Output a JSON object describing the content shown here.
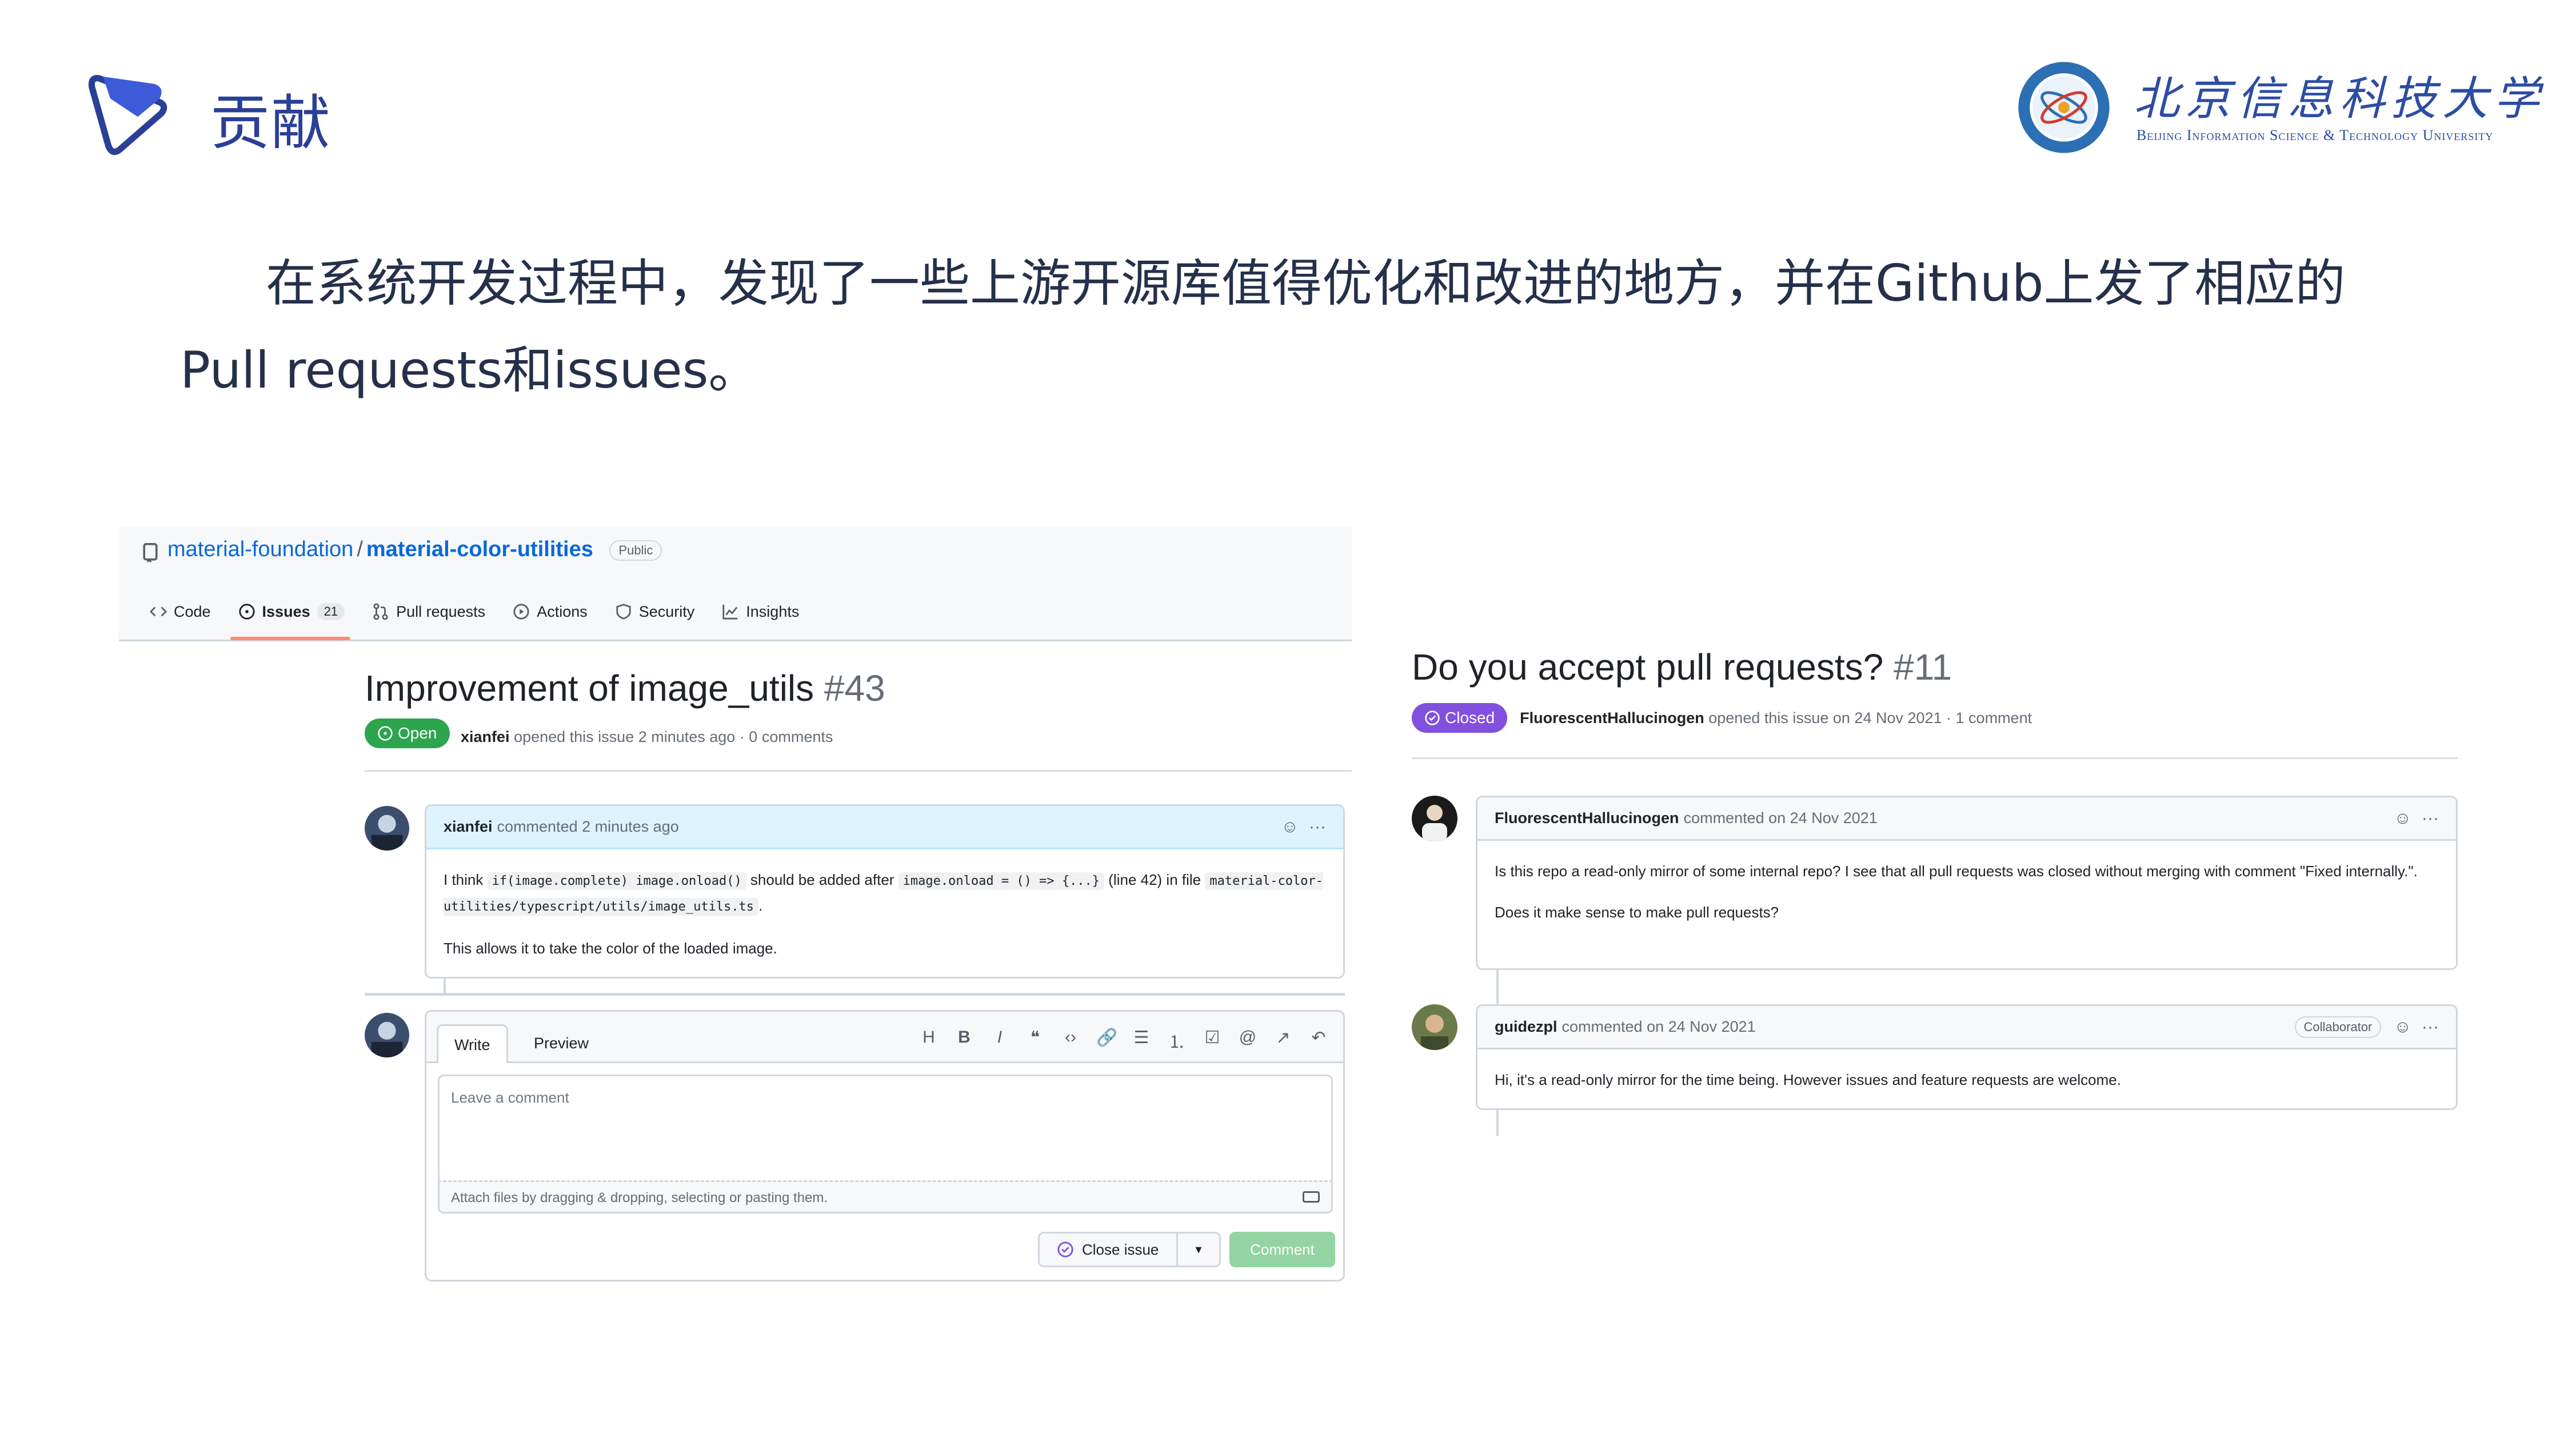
{
  "slide": {
    "title": "贡献",
    "university_cn": "北京信息科技大学",
    "university_en": "Beijing Information Science & Technology University",
    "intro": "在系统开发过程中，发现了一些上游开源库值得优化和改进的地方，并在Github上发了相应的Pull requests和issues。"
  },
  "left_issue": {
    "repo_owner": "material-foundation",
    "repo_sep": "/",
    "repo_name": "material-color-utilities",
    "visibility": "Public",
    "tabs": [
      {
        "label": "Code",
        "icon": "code-icon"
      },
      {
        "label": "Issues",
        "icon": "issue-icon",
        "counter": "21",
        "selected": true
      },
      {
        "label": "Pull requests",
        "icon": "pull-request-icon"
      },
      {
        "label": "Actions",
        "icon": "play-icon"
      },
      {
        "label": "Security",
        "icon": "shield-icon"
      },
      {
        "label": "Insights",
        "icon": "graph-icon"
      }
    ],
    "title": "Improvement of image_utils",
    "number": "#43",
    "state": "Open",
    "author": "xianfei",
    "meta": "opened this issue 2 minutes ago · 0 comments",
    "comment": {
      "author": "xianfei",
      "time": "commented 2 minutes ago",
      "p1_a": "I think ",
      "p1_code1": "if(image.complete) image.onload()",
      "p1_b": " should be added after ",
      "p1_code2": "image.onload = () => {...}",
      "p1_c": " (line 42) in file ",
      "p1_code3": "material-color-utilities/typescript/utils/image_utils.ts",
      "p1_d": ".",
      "p2": "This allows it to take the color of the loaded image."
    },
    "editor": {
      "tab_write": "Write",
      "tab_preview": "Preview",
      "toolbar": [
        "H",
        "B",
        "I",
        "❝",
        "‹›",
        "🔗",
        "☰",
        "⒈",
        "☑",
        "@",
        "↗",
        "↶"
      ],
      "placeholder": "Leave a comment",
      "attach": "Attach files by dragging & dropping, selecting or pasting them.",
      "close_button": "Close issue",
      "comment_button": "Comment"
    }
  },
  "right_issue": {
    "title": "Do you accept pull requests?",
    "number": "#11",
    "state": "Closed",
    "author": "FluorescentHallucinogen",
    "meta": "opened this issue on 24 Nov 2021 · 1 comment",
    "comments": [
      {
        "author": "FluorescentHallucinogen",
        "time": "commented on 24 Nov 2021",
        "p1": "Is this repo a read-only mirror of some internal repo? I see that all pull requests was closed without merging with comment \"Fixed internally.\".",
        "p2": "Does it make sense to make pull requests?"
      },
      {
        "author": "guidezpl",
        "time": "commented on 24 Nov 2021",
        "badge": "Collaborator",
        "p1": "Hi, it's a read-only mirror for the time being. However issues and feature requests are welcome."
      }
    ]
  },
  "colors": {
    "brand_blue": "#2a3f97",
    "open_green": "#2da44e",
    "closed_purple": "#8250df",
    "link_blue": "#0969da",
    "comment_disabled": "#94d3a2"
  }
}
